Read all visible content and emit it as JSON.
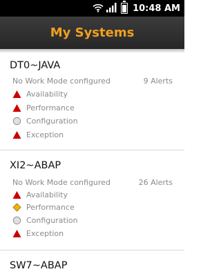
{
  "status_bar": {
    "time": "10:48 AM"
  },
  "title": "My Systems",
  "systems": [
    {
      "name": "DT0~JAVA",
      "work_mode": "No Work Mode configured",
      "alerts": "9 Alerts",
      "rows": [
        {
          "label": "Availability",
          "icon": "alert-triangle-icon"
        },
        {
          "label": "Performance",
          "icon": "alert-triangle-icon"
        },
        {
          "label": "Configuration",
          "icon": "neutral-circle-icon"
        },
        {
          "label": "Exception",
          "icon": "alert-triangle-icon"
        }
      ]
    },
    {
      "name": "XI2~ABAP",
      "work_mode": "No Work Mode configured",
      "alerts": "26 Alerts",
      "rows": [
        {
          "label": "Availability",
          "icon": "alert-triangle-icon"
        },
        {
          "label": "Performance",
          "icon": "warning-diamond-icon"
        },
        {
          "label": "Configuration",
          "icon": "neutral-circle-icon"
        },
        {
          "label": "Exception",
          "icon": "alert-triangle-icon"
        }
      ]
    },
    {
      "name": "SW7~ABAP"
    }
  ],
  "colors": {
    "accent": "#f0a020",
    "alert": "#cc0000",
    "warning": "#f2b400",
    "neutral": "#d0d0d0"
  }
}
